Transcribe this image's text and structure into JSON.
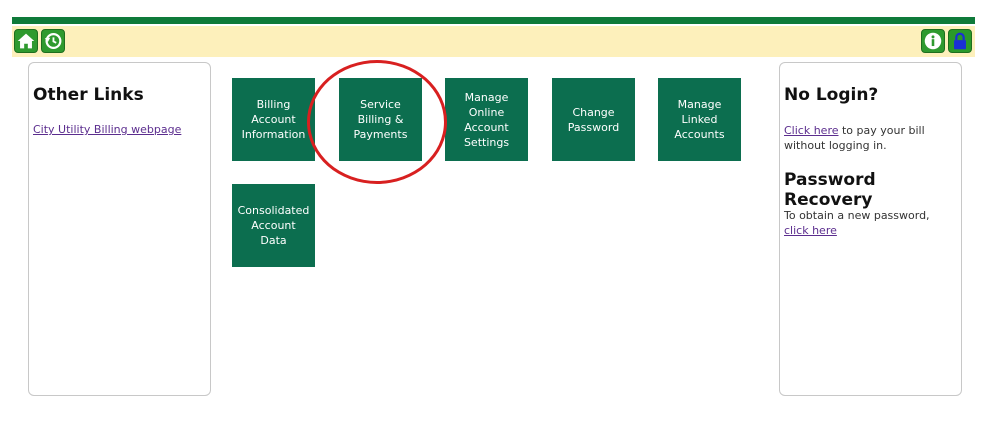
{
  "toolbar": {
    "icons": [
      "home-icon",
      "history-icon",
      "info-icon",
      "lock-icon"
    ],
    "colors": {
      "bar": "#0f7a3a",
      "toolbar_bg": "#fdf0bb",
      "icon_bg": "#2f9a2f",
      "lock": "#1a2fd6"
    }
  },
  "left_panel": {
    "title": "Other Links",
    "link": "City Utility Billing webpage"
  },
  "tiles": [
    {
      "label": "Billing Account Information"
    },
    {
      "label": "Service Billing & Payments"
    },
    {
      "label": "Manage Online Account Settings"
    },
    {
      "label": "Change Password"
    },
    {
      "label": "Manage Linked Accounts"
    },
    {
      "label": "Consolidated Account Data"
    }
  ],
  "tile_color": "#0c6e4f",
  "highlight_color": "#d82020",
  "right_panel": {
    "nologin_title": "No Login?",
    "nologin_link": "Click here",
    "nologin_text": " to pay your bill without logging in.",
    "pwrec_title": "Password Recovery",
    "pwrec_text": "To obtain a new password, ",
    "pwrec_link": "click here"
  }
}
